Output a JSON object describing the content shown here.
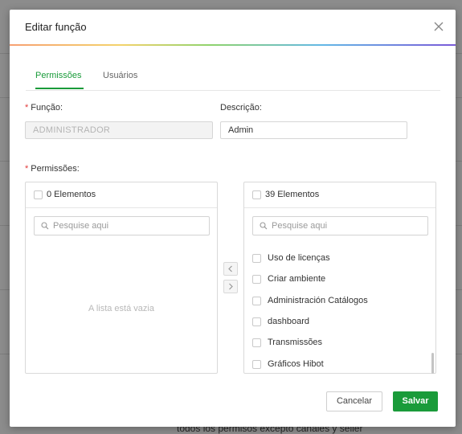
{
  "background": {
    "text": "todos los permisos excepto canales y seller"
  },
  "modal": {
    "title": "Editar função",
    "close_icon": "close-icon"
  },
  "tabs": [
    {
      "label": "Permissões",
      "active": true
    },
    {
      "label": "Usuários",
      "active": false
    }
  ],
  "form": {
    "funcao_label": "Função",
    "funcao_value": "ADMINISTRADOR",
    "descricao_label": "Descrição",
    "descricao_value": "Admin",
    "permissoes_label": "Permissões",
    "label_colon": ":",
    "required_mark": "*"
  },
  "transfer": {
    "left": {
      "count_label": "0 Elementos",
      "search_placeholder": "Pesquise aqui",
      "empty_text": "A lista está vazia"
    },
    "right": {
      "count_label": "39 Elementos",
      "search_placeholder": "Pesquise aqui",
      "items": [
        "Uso de licenças",
        "Criar ambiente",
        "Administración Catálogos",
        "dashboard",
        "Transmissões",
        "Gráficos Hibot"
      ]
    },
    "move_left_icon": "chevron-left-icon",
    "move_right_icon": "chevron-right-icon"
  },
  "footer": {
    "cancel_label": "Cancelar",
    "save_label": "Salvar"
  },
  "colors": {
    "accent": "#1a9b3a",
    "required": "#e23a3a"
  }
}
